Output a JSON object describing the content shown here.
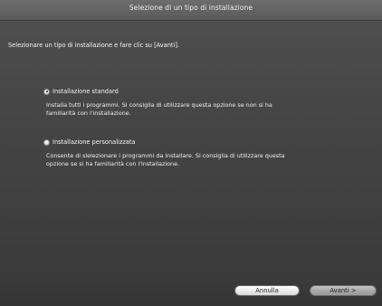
{
  "window": {
    "title": "Selezione di un tipo di installazione"
  },
  "main": {
    "instruction": "Selezionare un tipo di installazione e fare clic su [Avanti].",
    "options": [
      {
        "label": "Installazione standard",
        "selected": true,
        "description_lines": [
          "Installa tutti i programmi. Si consiglia di utilizzare questa opzione se non si ha",
          "familiarità con l'installazione."
        ]
      },
      {
        "label": "Installazione personalizzata",
        "selected": false,
        "description_lines": [
          "Consente di slelezionare i programmi da installare. Si consiglia di utilizzare questa",
          "opzione se si ha familiarità con l'installazione."
        ]
      }
    ]
  },
  "buttons": {
    "cancel_label": "Annulla",
    "next_label": "Avanti >"
  }
}
